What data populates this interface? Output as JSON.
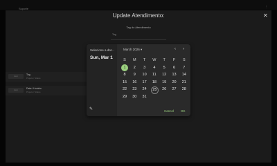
{
  "background": {
    "app_title": "Suporte",
    "row1_title": "Tag",
    "row1_sub": "Projeto / Status",
    "row2_title": "Data / Horário",
    "row2_sub": "Projeto / Status",
    "avatar_label": "icon"
  },
  "modal": {
    "title": "Update Atendimento:",
    "tag_label": "Tag do Atendimento",
    "tag_value": "Tag"
  },
  "picker": {
    "select_label": "Selecione a dat...",
    "selected_date": "Sun, Mar 1",
    "month_label": "March 2026",
    "weekdays": [
      "S",
      "M",
      "T",
      "W",
      "T",
      "F",
      "S"
    ],
    "weeks": [
      [
        "1",
        "2",
        "3",
        "4",
        "5",
        "6",
        "7"
      ],
      [
        "8",
        "9",
        "10",
        "11",
        "12",
        "13",
        "14"
      ],
      [
        "15",
        "16",
        "17",
        "18",
        "19",
        "20",
        "21"
      ],
      [
        "22",
        "23",
        "24",
        "25",
        "26",
        "27",
        "28"
      ],
      [
        "29",
        "30",
        "31",
        "",
        "",
        "",
        ""
      ]
    ],
    "selected_day": "1",
    "today_day": "25",
    "cancel_label": "Cancel",
    "ok_label": "OK",
    "accent_color": "#9bd07f"
  }
}
